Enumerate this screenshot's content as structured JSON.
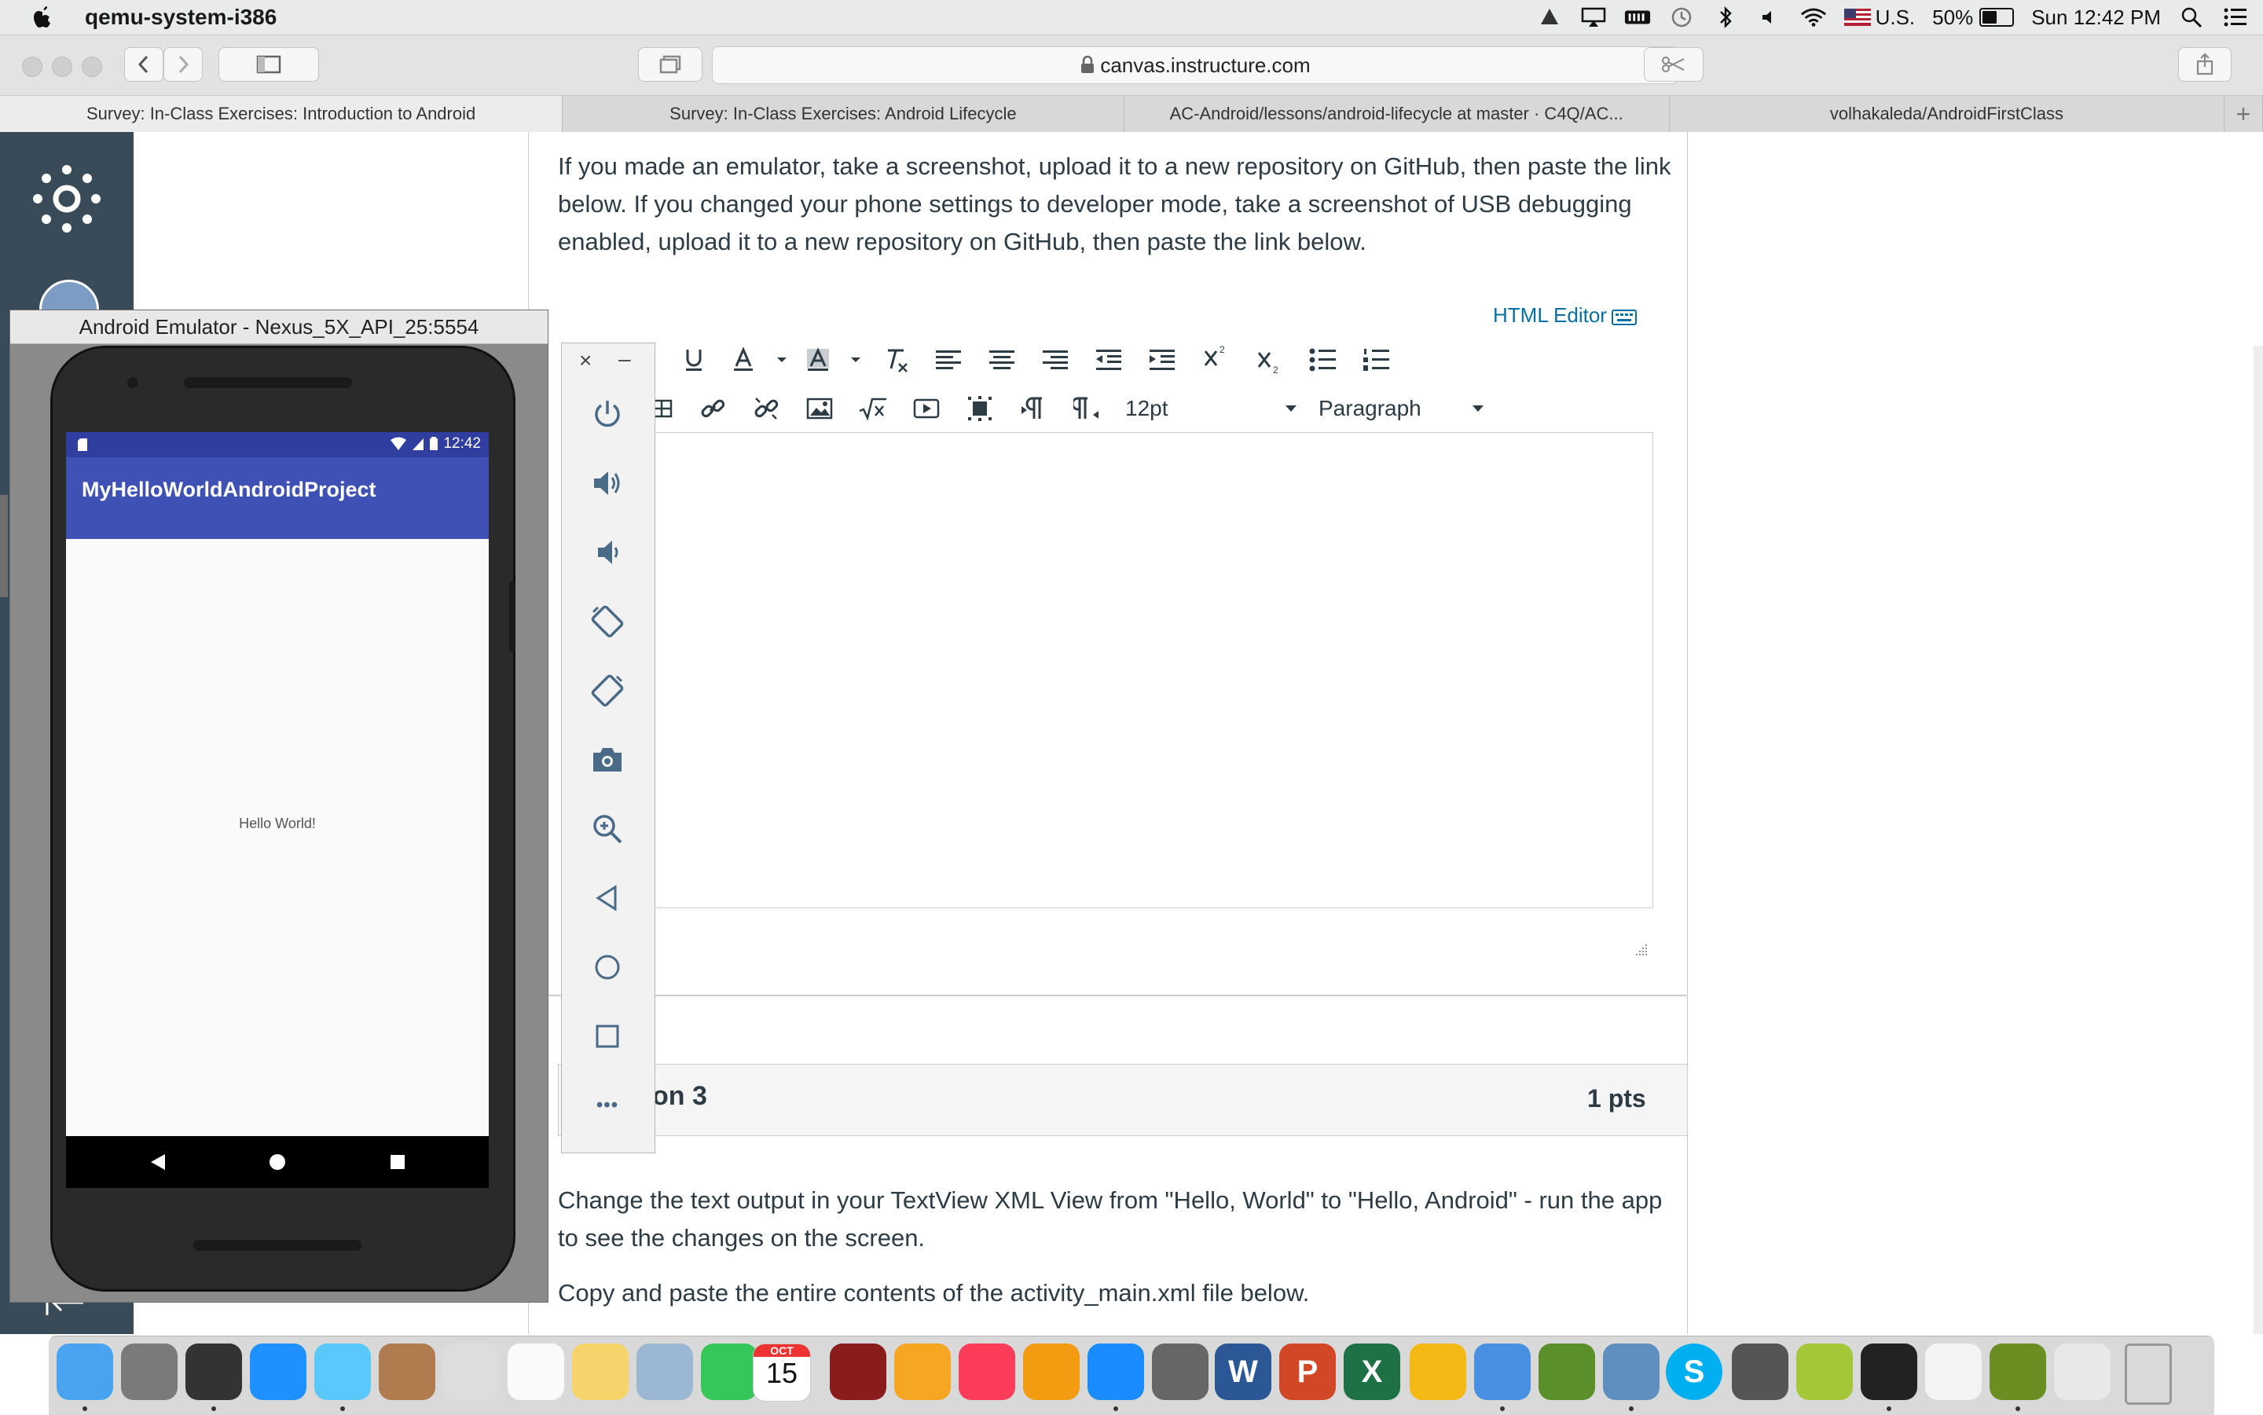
{
  "menubar": {
    "app_name": "qemu-system-i386",
    "input_source": "U.S.",
    "battery_percent": "50%",
    "battery_level": 0.5,
    "clock": "Sun 12:42 PM",
    "icons": [
      "apple-icon",
      "vagrant-icon",
      "airplay-icon",
      "memory-icon",
      "time-machine-icon",
      "bluetooth-icon",
      "volume-icon",
      "wifi-icon",
      "flag-icon",
      "battery-icon",
      "spotlight-icon",
      "notification-center-icon"
    ]
  },
  "browser": {
    "address": "canvas.instructure.com",
    "tabs": [
      {
        "label": "Survey: In-Class Exercises: Introduction to Android"
      },
      {
        "label": "Survey: In-Class Exercises: Android Lifecycle"
      },
      {
        "label": "AC-Android/lessons/android-lifecycle at master · C4Q/AC..."
      },
      {
        "label": "volhakaleda/AndroidFirstClass"
      }
    ],
    "new_tab_symbol": "+"
  },
  "question2": {
    "text": "If you made an emulator, take a screenshot, upload it to a new repository on GitHub, then paste the link below. If you changed your phone settings to developer mode, take a screenshot of USB debugging enabled, upload it to a new repository on GitHub, then paste the link below.",
    "html_editor_link": "HTML Editor",
    "font_size": "12pt",
    "block_format": "Paragraph"
  },
  "question3": {
    "title": "on 3",
    "points": "1 pts",
    "text1": "Change the text output in your TextView XML View from \"Hello, World\" to \"Hello, Android\" - run the app to see the changes on the screen.",
    "text2": "Copy and paste the entire contents of the activity_main.xml file below."
  },
  "emulator": {
    "window_title": "Android Emulator - Nexus_5X_API_25:5554",
    "status_time": "12:42",
    "app_title": "MyHelloWorldAndroidProject",
    "hello_text": "Hello World!",
    "panel_buttons": [
      "power-icon",
      "volume-up-icon",
      "volume-down-icon",
      "rotate-left-icon",
      "rotate-right-icon",
      "camera-icon",
      "zoom-icon",
      "back-icon",
      "home-icon",
      "overview-icon",
      "more-icon"
    ],
    "panel_close": "×",
    "panel_minimize": "–",
    "more_label": "•••"
  },
  "colors": {
    "canvas_nav": "#394b58",
    "android_primary": "#3f51b5",
    "android_primary_dark": "#303f9f",
    "link": "#0770a3",
    "text": "#2d3b45"
  },
  "dock": {
    "apps": [
      "finder",
      "launchpad",
      "activity-monitor",
      "safari",
      "messages",
      "contacts",
      "preview",
      "reminders",
      "notes",
      "xcode-ish",
      "facetime",
      "calendar",
      "photo-booth",
      "photos",
      "itunes",
      "ibooks",
      "app-store",
      "system-preferences",
      "word",
      "powerpoint",
      "excel",
      "sublime-o",
      "network",
      "globe",
      "dictionary",
      "skype",
      "sublime",
      "android-studio",
      "terminal",
      "textedit",
      "android-device",
      "downloads",
      "trash"
    ],
    "calendar_month": "OCT",
    "calendar_day": "15",
    "word_letter": "W",
    "powerpoint_letter": "P",
    "excel_letter": "X",
    "skype_letter": "S"
  }
}
